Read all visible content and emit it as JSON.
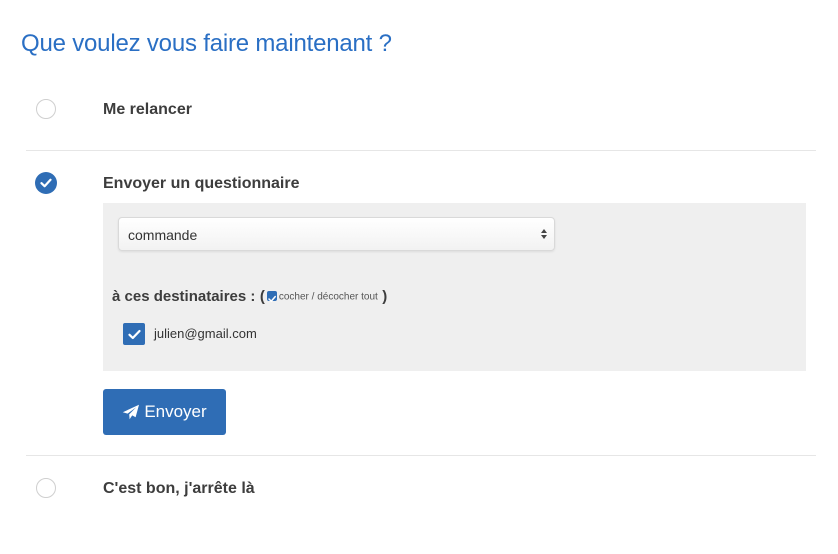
{
  "title": "Que voulez vous faire maintenant ?",
  "options": [
    {
      "label": "Me relancer",
      "selected": false
    },
    {
      "label": "Envoyer un questionnaire",
      "selected": true
    },
    {
      "label": "C'est bon, j'arrête là",
      "selected": false
    }
  ],
  "questionnaire": {
    "select_value": "commande",
    "recipients_label": "à ces destinataires :",
    "paren_open": "(",
    "paren_close": ")",
    "toggle_all_label": "cocher / décocher tout",
    "toggle_all_checked": true,
    "recipients": [
      {
        "email": "julien@gmail.com",
        "checked": true
      }
    ],
    "send_label": "Envoyer",
    "send_icon": "paper-plane-icon"
  },
  "colors": {
    "accent": "#2f6db5",
    "title": "#2a6fc4",
    "panel_bg": "#efefef"
  }
}
